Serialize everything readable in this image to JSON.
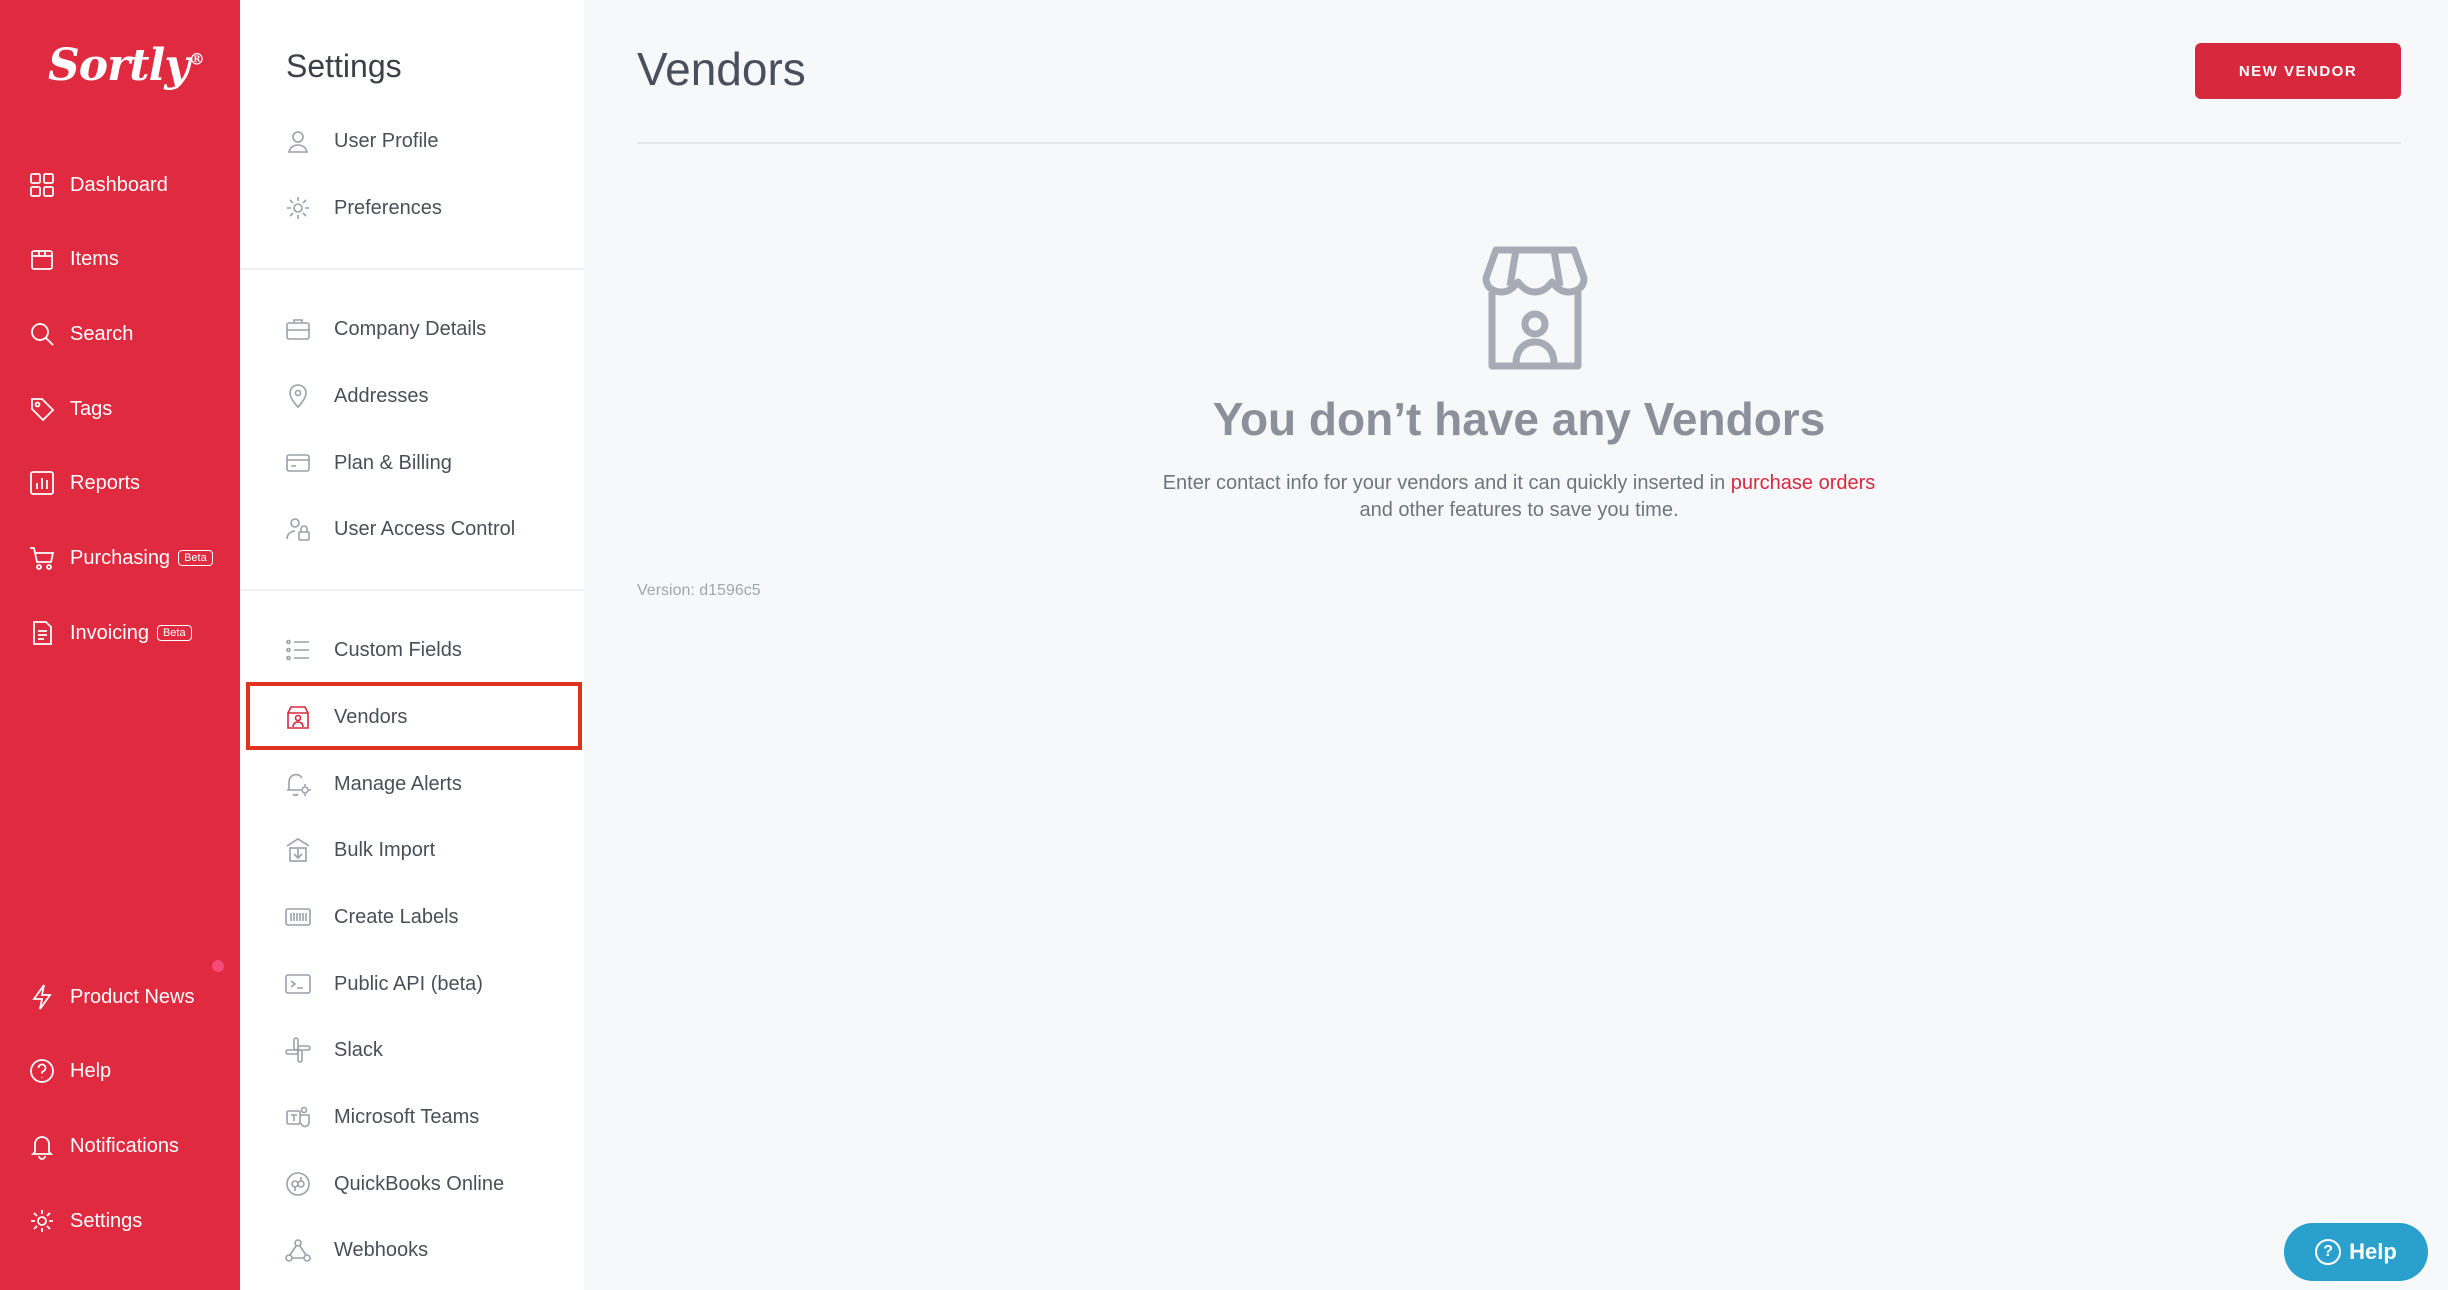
{
  "brand": {
    "logo": "Sortly",
    "reg": "®",
    "color": "#e02a3f"
  },
  "nav": {
    "items": [
      {
        "label": "Dashboard",
        "icon": "dashboard-icon"
      },
      {
        "label": "Items",
        "icon": "items-icon"
      },
      {
        "label": "Search",
        "icon": "search-icon"
      },
      {
        "label": "Tags",
        "icon": "tag-icon"
      },
      {
        "label": "Reports",
        "icon": "reports-icon"
      },
      {
        "label": "Purchasing",
        "icon": "cart-icon",
        "badge": "Beta"
      },
      {
        "label": "Invoicing",
        "icon": "invoice-icon",
        "badge": "Beta"
      }
    ],
    "bottom": [
      {
        "label": "Product News",
        "icon": "lightning-icon"
      },
      {
        "label": "Help",
        "icon": "help-icon"
      },
      {
        "label": "Notifications",
        "icon": "bell-icon"
      },
      {
        "label": "Settings",
        "icon": "gear-icon"
      }
    ]
  },
  "settings": {
    "title": "Settings",
    "items": [
      {
        "label": "User Profile",
        "icon": "user-icon"
      },
      {
        "label": "Preferences",
        "icon": "gear-icon"
      },
      {
        "label": "Company Details",
        "icon": "briefcase-icon"
      },
      {
        "label": "Addresses",
        "icon": "location-pin-icon"
      },
      {
        "label": "Plan & Billing",
        "icon": "credit-card-icon"
      },
      {
        "label": "User Access Control",
        "icon": "user-lock-icon"
      },
      {
        "label": "Custom Fields",
        "icon": "list-icon"
      },
      {
        "label": "Vendors",
        "icon": "store-icon",
        "active": true
      },
      {
        "label": "Manage Alerts",
        "icon": "bell-gear-icon"
      },
      {
        "label": "Bulk Import",
        "icon": "import-icon"
      },
      {
        "label": "Create Labels",
        "icon": "barcode-icon"
      },
      {
        "label": "Public API (beta)",
        "icon": "terminal-icon"
      },
      {
        "label": "Slack",
        "icon": "slack-icon"
      },
      {
        "label": "Microsoft Teams",
        "icon": "teams-icon"
      },
      {
        "label": "QuickBooks Online",
        "icon": "quickbooks-icon"
      },
      {
        "label": "Webhooks",
        "icon": "webhook-icon"
      }
    ]
  },
  "main": {
    "title": "Vendors",
    "new_button": "NEW VENDOR",
    "empty_title": "You don’t have any Vendors",
    "empty_desc_1": "Enter contact info for your vendors and it can quickly inserted in ",
    "empty_desc_link": "purchase orders",
    "empty_desc_2": "and other features to save you time.",
    "version": "Version: d1596c5"
  },
  "help_button": {
    "label": "Help",
    "icon_glyph": "?"
  }
}
